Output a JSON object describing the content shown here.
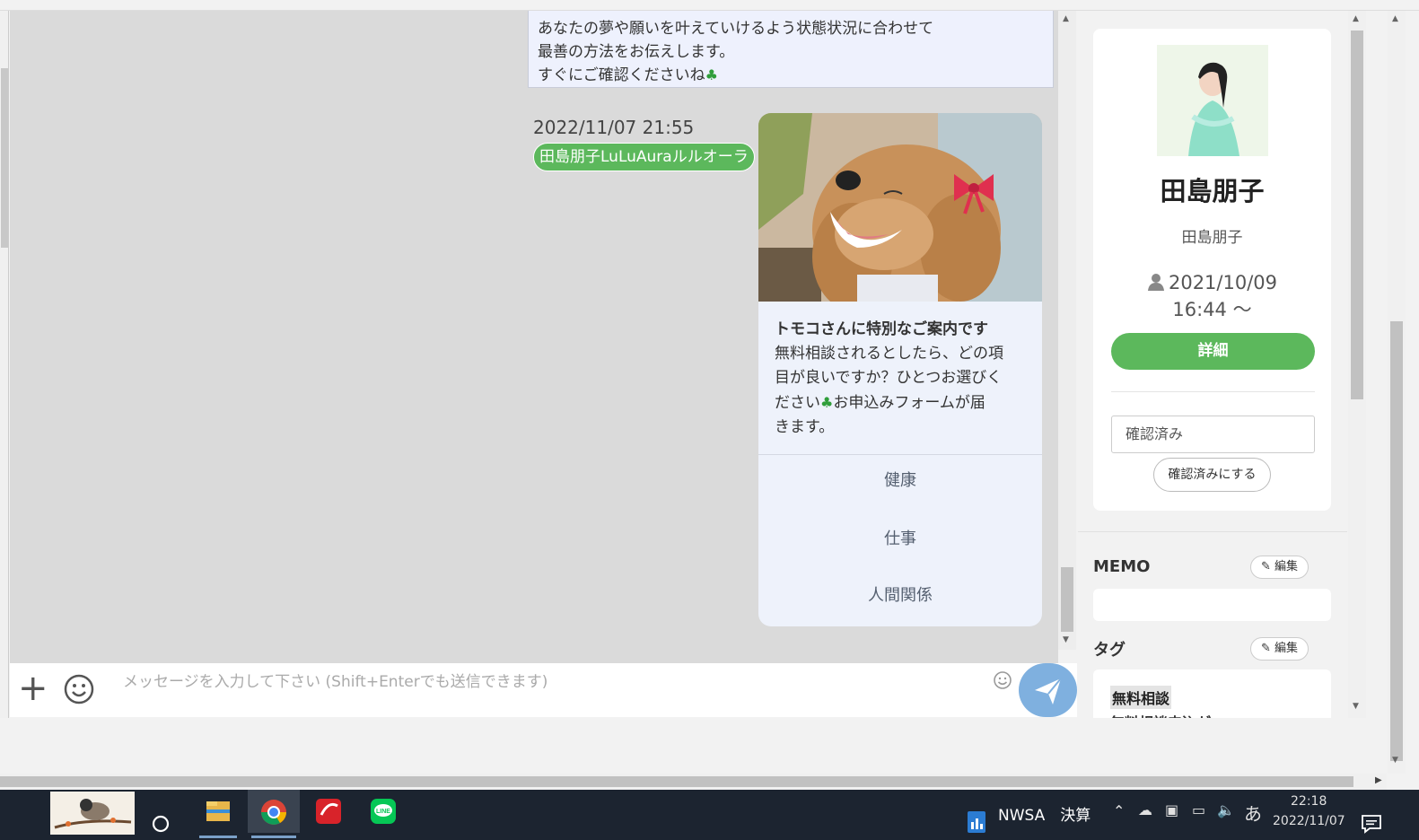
{
  "chat": {
    "previous_message_lines": [
      "あなたの夢や願いを叶えていけるよう状態状況に合わせて",
      "最善の方法をお伝えします。",
      "すぐにご確認くださいね"
    ],
    "message_time": "2022/11/07 21:55",
    "sender_name": "田島朋子LuLuAuraルルオーラ",
    "card": {
      "title": "トモコさんに特別なご案内です",
      "text_lines": [
        "無料相談されるとしたら、どの項",
        "目が良いですか？ひとつお選びく",
        "ださい",
        "きます。"
      ],
      "text_line3_suffix": "お申込みフォームが届",
      "options": [
        "健康",
        "仕事",
        "人間関係"
      ]
    }
  },
  "composer": {
    "placeholder": "メッセージを入力して下さい (Shift+Enterでも送信できます)"
  },
  "profile": {
    "display_name": "田島朋子",
    "sub_name": "田島朋子",
    "date_line1": "2021/10/09",
    "date_line2": "16:44 ～",
    "detail_button": "詳細",
    "status_value": "確認済み",
    "confirm_button": "確認済みにする",
    "memo_label": "MEMO",
    "memo_edit": "編集",
    "tag_label": "タグ",
    "tag_edit": "編集",
    "tags": [
      "無料相談",
      "無料相談申込が"
    ]
  },
  "taskbar": {
    "doc_name": "NWSA　決算",
    "ime": "あ",
    "time": "22:18",
    "date": "2022/11/07"
  },
  "colors": {
    "accent_green": "#5cb85c",
    "send_blue": "#7fb0df",
    "chat_bg": "#dadada",
    "bubble_bg": "#eef1fd"
  }
}
